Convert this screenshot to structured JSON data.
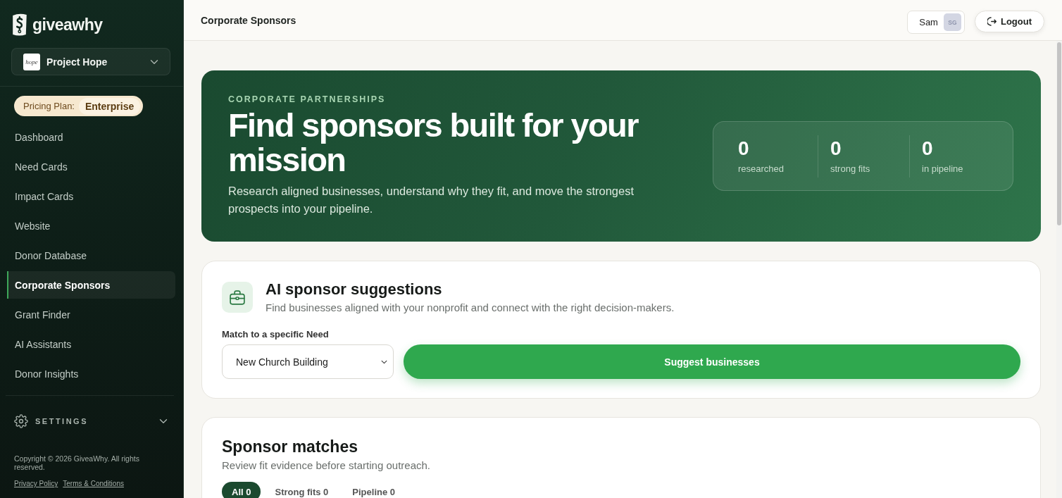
{
  "sidebar": {
    "logo": {
      "text": "giveawhy"
    },
    "project": {
      "logo_text": "hope",
      "name": "Project Hope"
    },
    "plan": {
      "label": "Pricing Plan:",
      "value": "Enterprise"
    },
    "nav": [
      {
        "label": "Dashboard",
        "selected": false
      },
      {
        "label": "Need Cards",
        "selected": false
      },
      {
        "label": "Impact Cards",
        "selected": false
      },
      {
        "label": "Website",
        "selected": false
      },
      {
        "label": "Donor Database",
        "selected": false
      },
      {
        "label": "Corporate Sponsors",
        "selected": true
      },
      {
        "label": "Grant Finder",
        "selected": false
      },
      {
        "label": "AI Assistants",
        "selected": false
      },
      {
        "label": "Donor Insights",
        "selected": false
      }
    ],
    "settings": {
      "label": "SETTINGS",
      "expanded": false
    },
    "footer": {
      "copyright": "Copyright © 2026 GiveaWhy. All rights reserved.",
      "links": [
        "Privacy Policy",
        "Terms & Conditions"
      ]
    }
  },
  "header": {
    "title": "Corporate Sponsors",
    "user": {
      "name": "Sam",
      "initials": "SG"
    },
    "logout": "Logout"
  },
  "hero": {
    "eyebrow": "CORPORATE PARTNERSHIPS",
    "title": "Find sponsors built for your mission",
    "description": "Research aligned businesses, understand why they fit, and move the strongest prospects into your pipeline.",
    "stats": [
      {
        "value": "0",
        "label": "researched"
      },
      {
        "value": "0",
        "label": "strong fits"
      },
      {
        "value": "0",
        "label": "in pipeline"
      }
    ]
  },
  "suggestions": {
    "title": "AI sponsor suggestions",
    "description": "Find businesses aligned with your nonprofit and connect with the right decision-makers.",
    "field_label": "Match to a specific Need",
    "select_value": "New Church Building",
    "button": "Suggest businesses"
  },
  "matches": {
    "title": "Sponsor matches",
    "description": "Review fit evidence before starting outreach.",
    "tabs": [
      {
        "label": "All 0",
        "selected": true
      },
      {
        "label": "Strong fits 0",
        "selected": false
      },
      {
        "label": "Pipeline 0",
        "selected": false
      }
    ]
  }
}
